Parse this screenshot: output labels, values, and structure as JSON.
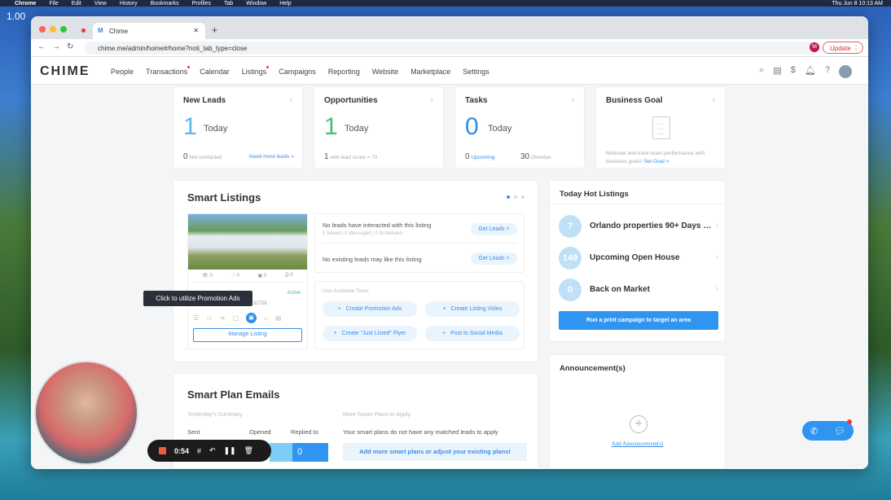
{
  "menubar": {
    "app": "Chrome",
    "items": [
      "File",
      "Edit",
      "View",
      "History",
      "Bookmarks",
      "Profiles",
      "Tab",
      "Window",
      "Help"
    ],
    "clock": "Thu Jun 8  10:13 AM"
  },
  "zoom_label": "1.00",
  "browser": {
    "tab_title": "Chime",
    "url": "chime.me/admin/home#/home?noti_tab_type=close",
    "update_label": "Update",
    "profile_initial": "M"
  },
  "nav": {
    "logo": "CHIME",
    "items": [
      {
        "label": "People"
      },
      {
        "label": "Transactions",
        "badge": true
      },
      {
        "label": "Calendar"
      },
      {
        "label": "Listings",
        "badge": true
      },
      {
        "label": "Campaigns"
      },
      {
        "label": "Reporting"
      },
      {
        "label": "Website"
      },
      {
        "label": "Marketplace"
      },
      {
        "label": "Settings"
      }
    ]
  },
  "cards": {
    "new_leads": {
      "title": "New Leads",
      "value": "1",
      "unit": "Today",
      "sub_count": "0",
      "sub_label": "Not contacted",
      "link": "Need more leads >",
      "color": "#5ab8f0"
    },
    "opportunities": {
      "title": "Opportunities",
      "value": "1",
      "unit": "Today",
      "sub_count": "1",
      "sub_label": "with lead score > 70",
      "color": "#3cc47c"
    },
    "tasks": {
      "title": "Tasks",
      "value": "0",
      "unit": "Today",
      "upcoming_count": "0",
      "upcoming_label": "Upcoming",
      "overdue_count": "30",
      "overdue_label": "Overdue",
      "color": "#2f8fe8"
    },
    "business_goal": {
      "title": "Business Goal",
      "text": "Motivate and track team performance with business goals!",
      "link": "Set Goal >"
    }
  },
  "smart_listings": {
    "title": "Smart Listings",
    "stats": [
      "0",
      "0",
      "0",
      "0"
    ],
    "status": "Active",
    "zip": "32726",
    "tooltip": "Click to utilize Promotion Ads",
    "manage": "Manage Listing",
    "insights": [
      {
        "text": "No leads have interacted with this listing",
        "sub": "0 Saved | 0 Messaged | 0 Scheduled",
        "button": "Get Leads >"
      },
      {
        "text": "No existing leads may like this listing",
        "sub": "",
        "button": "Get Leads >"
      }
    ],
    "tools_label": "Use Available Tools:",
    "tools": [
      "Create Promotion Ads",
      "Create Listing Video",
      "Create \"Just Listed\" Flyer",
      "Post to Social Media"
    ]
  },
  "hot": {
    "title": "Today Hot Listings",
    "items": [
      {
        "count": "7",
        "label": "Orlando properties 90+ Days on Market"
      },
      {
        "count": "149",
        "label": "Upcoming Open House"
      },
      {
        "count": "0",
        "label": "Back on Market"
      }
    ],
    "button": "Run a print campaign to target an area"
  },
  "smart_plan": {
    "title": "Smart Plan Emails",
    "summary_label": "Yesterday's Summary",
    "cols": [
      "Sent",
      "Opened",
      "Replied to"
    ],
    "replied": "0",
    "more_label": "More Smart Plans to Apply",
    "more_text": "Your smart plans do not have any matched leads to apply",
    "more_button": "Add more smart plans or adjust your existing plans!"
  },
  "announcements": {
    "title": "Announcement(s)",
    "add": "Add Announcement(s)"
  },
  "recorder": {
    "time": "0:54"
  }
}
